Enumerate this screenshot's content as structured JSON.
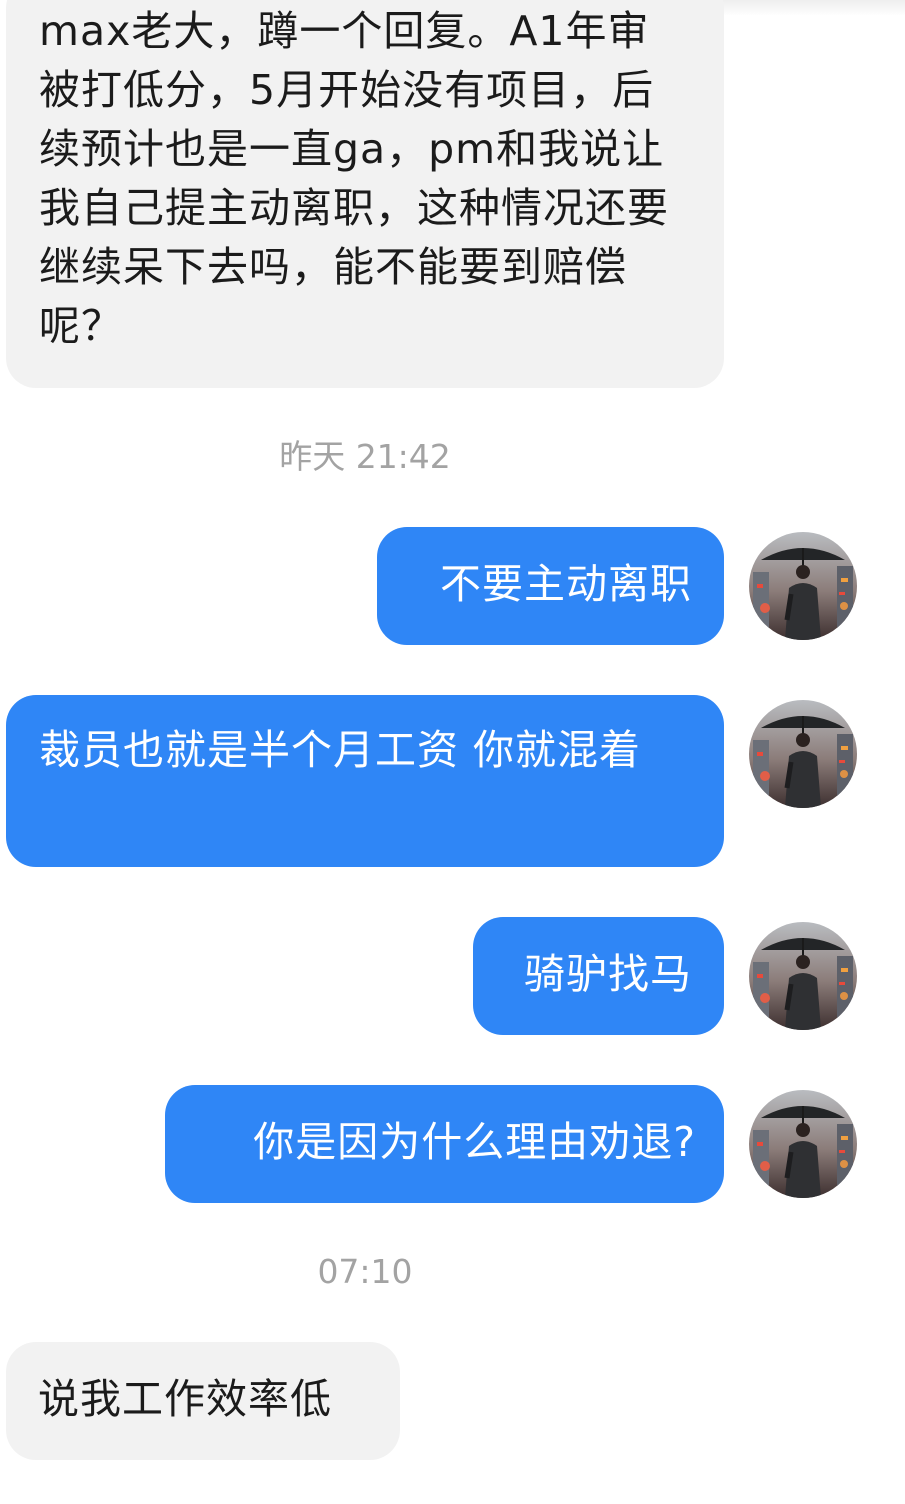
{
  "chat": {
    "messages": [
      {
        "direction": "incoming",
        "text": "max老大，蹲一个回复。A1年审被打低分，5月开始没有项目，后续预计也是一直ga，pm和我说让我自己提主动离职，这种情况还要继续呆下去吗，能不能要到赔偿呢？"
      },
      {
        "type": "timestamp",
        "text": "昨天 21:42"
      },
      {
        "direction": "outgoing",
        "text": "不要主动离职",
        "avatar": "user-avatar-umbrella"
      },
      {
        "direction": "outgoing",
        "text": "裁员也就是半个月工资 你就混着",
        "avatar": "user-avatar-umbrella"
      },
      {
        "direction": "outgoing",
        "text": "骑驴找马",
        "avatar": "user-avatar-umbrella"
      },
      {
        "direction": "outgoing",
        "text": "你是因为什么理由劝退?",
        "avatar": "user-avatar-umbrella"
      },
      {
        "type": "timestamp",
        "text": "07:10"
      },
      {
        "direction": "incoming",
        "text": "说我工作效率低"
      }
    ]
  },
  "colors": {
    "outgoing_bubble": "#2f86f6",
    "incoming_bubble": "#f2f2f2",
    "timestamp_text": "#a3a3a3"
  }
}
